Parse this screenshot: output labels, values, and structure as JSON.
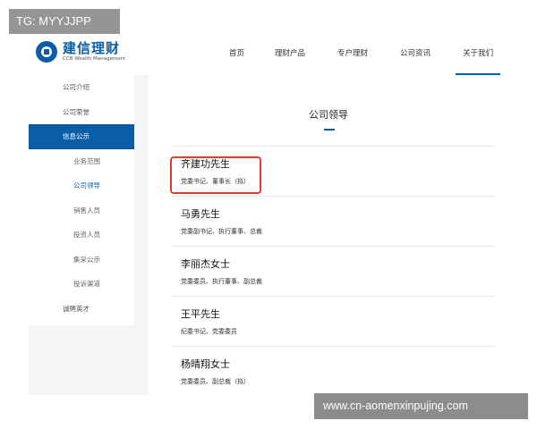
{
  "watermarks": {
    "top_left": "TG: MYYJJPP",
    "bottom_right": "www.cn-aomenxinpujing.com"
  },
  "logo": {
    "name": "建信理财",
    "subtitle": "CCB Wealth Management"
  },
  "nav": {
    "items": [
      {
        "label": "首页"
      },
      {
        "label": "理财产品"
      },
      {
        "label": "专户理财"
      },
      {
        "label": "公司资讯"
      },
      {
        "label": "关于我们",
        "active": true
      }
    ]
  },
  "sidebar": {
    "items": [
      {
        "label": "公司介绍"
      },
      {
        "label": "公司荣誉"
      },
      {
        "label": "信息公示",
        "active": true
      },
      {
        "label": "业务范围"
      },
      {
        "label": "公司领导",
        "current": true
      },
      {
        "label": "销售人员"
      },
      {
        "label": "投资人员"
      },
      {
        "label": "集采公示"
      },
      {
        "label": "投诉渠道"
      },
      {
        "label": "诚聘英才"
      }
    ]
  },
  "main": {
    "title": "公司领导",
    "leaders": [
      {
        "name": "齐建功先生",
        "role": "党委书记、董事长（拟）",
        "highlighted": true
      },
      {
        "name": "马勇先生",
        "role": "党委副书记、执行董事、总裁"
      },
      {
        "name": "李丽杰女士",
        "role": "党委委员、执行董事、副总裁"
      },
      {
        "name": "王平先生",
        "role": "纪委书记、党委委员"
      },
      {
        "name": "杨晴翔女士",
        "role": "党委委员、副总裁（拟）"
      }
    ]
  },
  "colors": {
    "brand": "#0a5ea8",
    "highlight_border": "#d8412f"
  }
}
